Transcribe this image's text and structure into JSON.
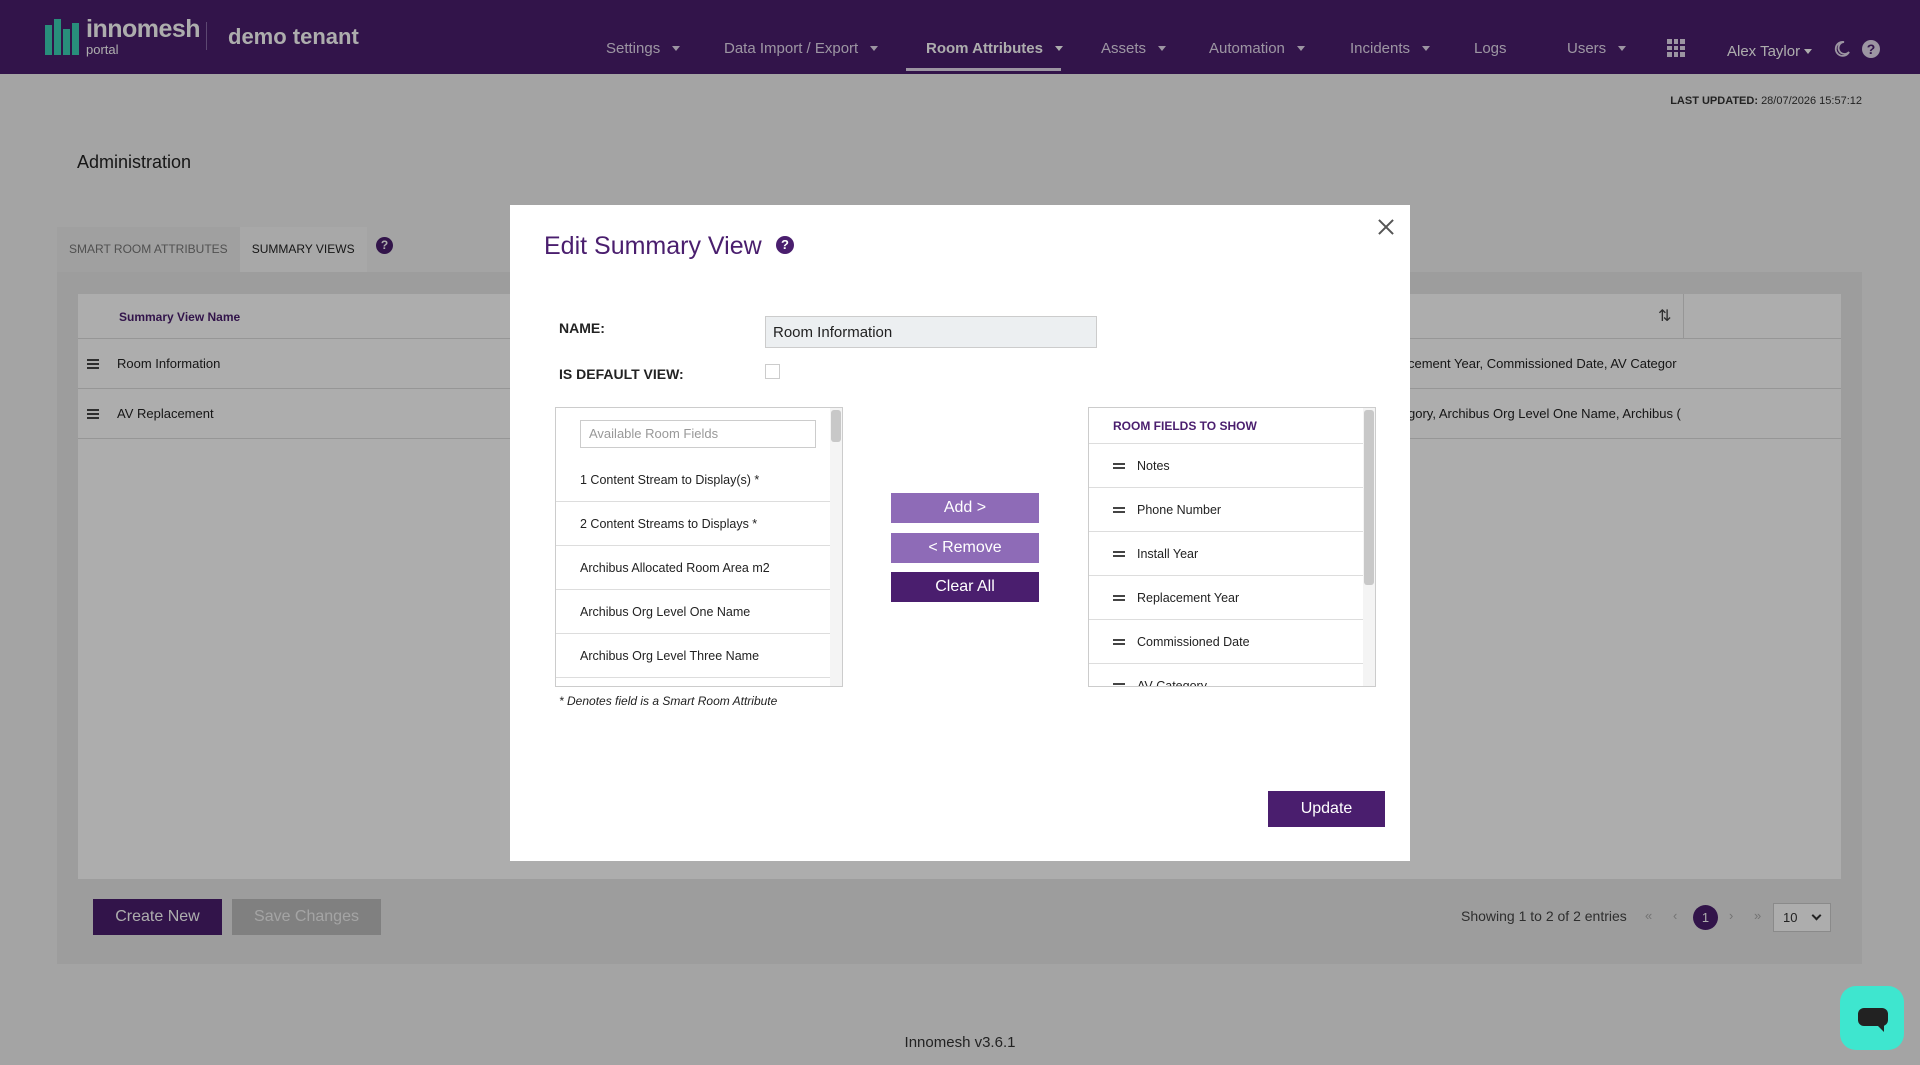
{
  "brand": {
    "name": "innomesh",
    "sub": "portal",
    "tenant": "demo tenant"
  },
  "nav": {
    "items": [
      {
        "label": "Settings",
        "dropdown": true
      },
      {
        "label": "Data Import / Export",
        "dropdown": true
      },
      {
        "label": "Room Attributes",
        "dropdown": true,
        "active": true
      },
      {
        "label": "Assets",
        "dropdown": true
      },
      {
        "label": "Automation",
        "dropdown": true
      },
      {
        "label": "Incidents",
        "dropdown": true
      },
      {
        "label": "Logs",
        "dropdown": false
      },
      {
        "label": "Users",
        "dropdown": true
      }
    ],
    "user": "Alex Taylor",
    "help": "?"
  },
  "last_updated": {
    "label": "LAST UPDATED:",
    "value": "28/07/2026 15:57:12"
  },
  "page": {
    "title": "Administration",
    "tabs": [
      "SMART ROOM ATTRIBUTES",
      "SUMMARY VIEWS"
    ],
    "tab_help": "?"
  },
  "table": {
    "header_name": "Summary View Name",
    "rows": [
      {
        "name": "Room Information",
        "fields": "cement Year, Commissioned Date, AV Categor"
      },
      {
        "name": "AV Replacement",
        "fields": "gory, Archibus Org Level One Name, Archibus ("
      }
    ]
  },
  "buttons": {
    "create": "Create New",
    "save": "Save Changes"
  },
  "pager": {
    "info": "Showing 1 to 2 of 2 entries",
    "first": "«",
    "prev": "‹",
    "current": "1",
    "next": "›",
    "last": "»",
    "per_page": "10"
  },
  "footer": "Innomesh v3.6.1",
  "modal": {
    "title": "Edit Summary View",
    "help": "?",
    "name_label": "NAME:",
    "name_value": "Room Information",
    "default_label": "IS DEFAULT VIEW:",
    "available_placeholder": "Available Room Fields",
    "available_fields": [
      "1 Content Stream to Display(s) *",
      "2 Content Streams to Displays *",
      "Archibus Allocated Room Area m2",
      "Archibus Org Level One Name",
      "Archibus Org Level Three Name"
    ],
    "add": "Add >",
    "remove": "< Remove",
    "clear": "Clear All",
    "show_header": "ROOM FIELDS TO SHOW",
    "show_fields": [
      "Notes",
      "Phone Number",
      "Install Year",
      "Replacement Year",
      "Commissioned Date",
      "AV Category"
    ],
    "note": "* Denotes field is a Smart Room Attribute",
    "update": "Update"
  },
  "colors": {
    "brand": "#4a1e6e",
    "accent": "#3bd1b6",
    "button_light": "#8e6bb7",
    "chat": "#3ee6cf"
  },
  "icons": [
    "grid-icon",
    "moon-icon",
    "help-icon",
    "close-icon",
    "sort-icon",
    "drag-handle-icon",
    "chat-icon"
  ]
}
